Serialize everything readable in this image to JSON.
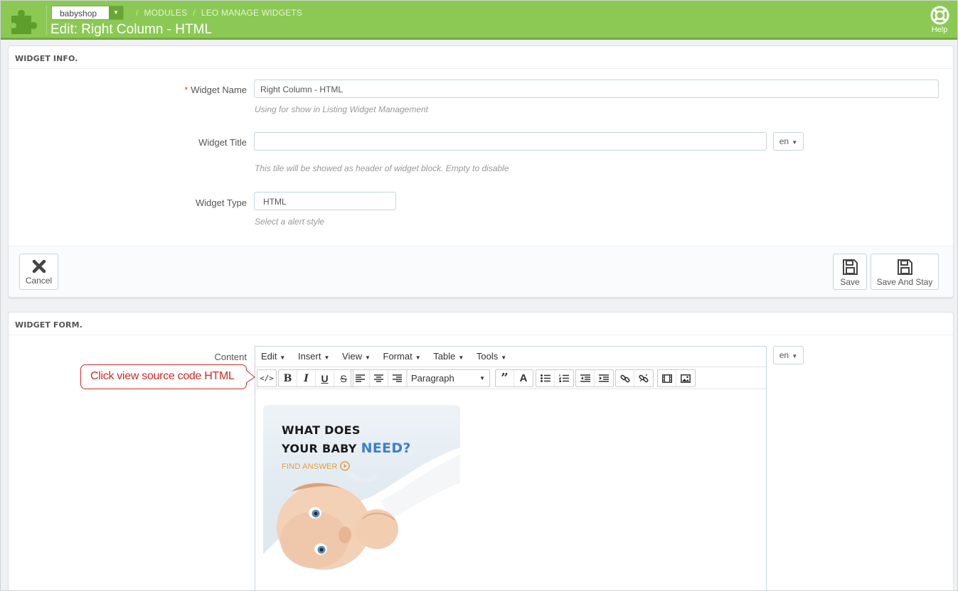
{
  "header": {
    "shop": "babyshop",
    "breadcrumbs": [
      "MODULES",
      "LEO MANAGE WIDGETS"
    ],
    "title": "Edit: Right Column - HTML",
    "help_label": "Help"
  },
  "widget_info": {
    "heading": "WIDGET INFO.",
    "name_label": "Widget Name",
    "name_value": "Right Column - HTML",
    "name_help": "Using for show in Listing Widget Management",
    "title_label": "Widget Title",
    "title_value": "",
    "title_help": "This tile will be showed as header of widget block. Empty to disable",
    "lang": "en",
    "type_label": "Widget Type",
    "type_value": "HTML",
    "type_help": "Select a alert style",
    "cancel_label": "Cancel",
    "save_label": "Save",
    "save_stay_label": "Save And Stay"
  },
  "widget_form": {
    "heading": "WIDGET FORM.",
    "content_label": "Content",
    "lang": "en",
    "menus": [
      "Edit",
      "Insert",
      "View",
      "Format",
      "Table",
      "Tools"
    ],
    "format_select": "Paragraph",
    "callout": "Click view source code HTML",
    "banner": {
      "line1": "WHAT DOES",
      "line2": "YOUR BABY",
      "line2_highlight": "NEED?",
      "link": "FIND ANSWER"
    }
  },
  "colors": {
    "header_green": "#8bc954",
    "required": "#e74c3c",
    "callout_red": "#d42a2a",
    "banner_blue": "#3b7fd0",
    "banner_orange": "#e69a3b"
  }
}
